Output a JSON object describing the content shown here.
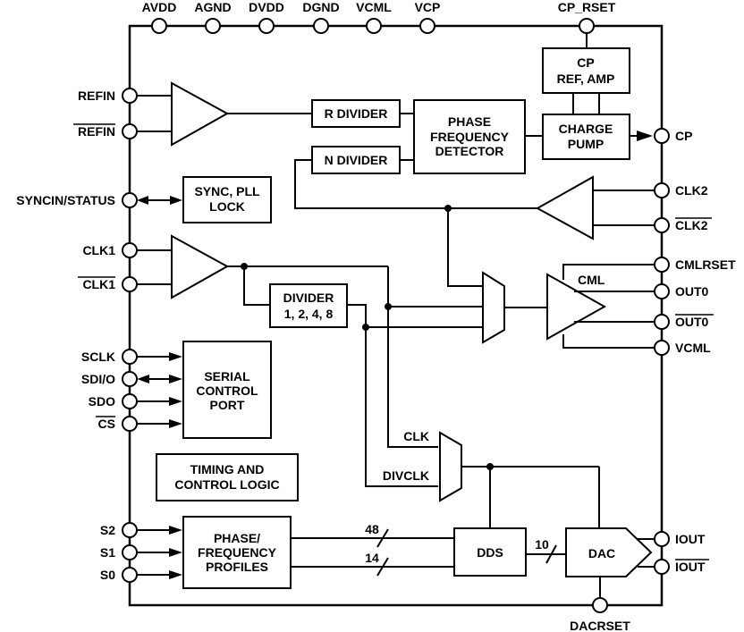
{
  "top_pins": [
    "AVDD",
    "AGND",
    "DVDD",
    "DGND",
    "VCML",
    "VCP"
  ],
  "cp_rset": "CP_RSET",
  "left_pins": {
    "refin": "REFIN",
    "refin_b": "REFIN",
    "syncin": "SYNCIN/STATUS",
    "clk1": "CLK1",
    "clk1_b": "CLK1",
    "sclk": "SCLK",
    "sdio": "SDI/O",
    "sdo": "SDO",
    "cs": "CS",
    "s2": "S2",
    "s1": "S1",
    "s0": "S0"
  },
  "right_pins": {
    "cp": "CP",
    "clk2": "CLK2",
    "clk2_b": "CLK2",
    "cmlrset": "CMLRSET",
    "out0": "OUT0",
    "out0_b": "OUT0",
    "vcml": "VCML",
    "iout": "IOUT",
    "iout_b": "IOUT"
  },
  "bottom_pin": "DACRSET",
  "blocks": {
    "cp_ref": [
      "CP",
      "REF, AMP"
    ],
    "charge_pump": [
      "CHARGE",
      "PUMP"
    ],
    "r_divider": "R DIVIDER",
    "n_divider": "N DIVIDER",
    "pfd": [
      "PHASE",
      "FREQUENCY",
      "DETECTOR"
    ],
    "sync_pll": [
      "SYNC, PLL",
      "LOCK"
    ],
    "divider": [
      "DIVIDER",
      "1, 2, 4, 8"
    ],
    "serial_port": [
      "SERIAL",
      "CONTROL",
      "PORT"
    ],
    "timing": [
      "TIMING AND",
      "CONTROL LOGIC"
    ],
    "profiles": [
      "PHASE/",
      "FREQUENCY",
      "PROFILES"
    ],
    "dds": "DDS",
    "dac": "DAC"
  },
  "labels": {
    "cml": "CML",
    "clk": "CLK",
    "divclk": "DIVCLK",
    "bus48": "48",
    "bus14": "14",
    "bus10": "10"
  }
}
